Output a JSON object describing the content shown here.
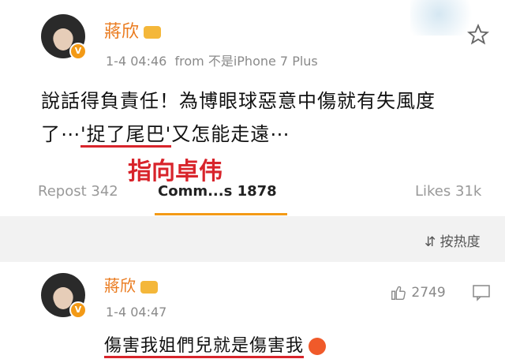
{
  "post": {
    "author": "蔣欣",
    "time": "1-4 04:46",
    "from_label": "from",
    "device": "不是iPhone 7 Plus",
    "text_line1": "說話得負責任！為博眼球惡意中傷就有失風度",
    "text_line2_prefix": "了⋯",
    "text_line2_quote": "'捉了尾巴'",
    "text_line2_suffix": "又怎能走遠⋯",
    "annotation": "指向卓伟"
  },
  "stats": {
    "repost_label": "Repost 342",
    "comments_label": "Comm...s 1878",
    "likes_label": "Likes 31k"
  },
  "sort": {
    "label": "按热度"
  },
  "comment": {
    "author": "蔣欣",
    "time": "1-4 04:47",
    "likes": "2749",
    "text": "傷害我姐們兒就是傷害我"
  },
  "colors": {
    "name": "#ea7a1d",
    "accent": "#f39a16",
    "annotation": "#d8242b"
  }
}
